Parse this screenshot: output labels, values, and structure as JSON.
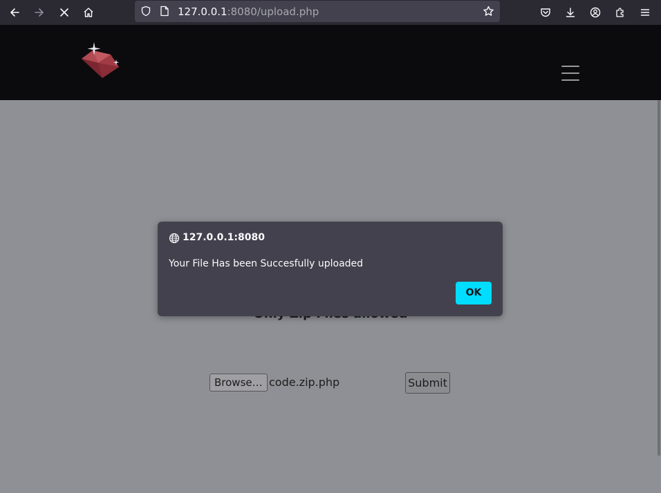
{
  "browser": {
    "url_host": "127.0.0.1",
    "url_rest": ":8080/upload.php"
  },
  "page": {
    "notice": "Only Zip Files allowed",
    "browse_label": "Browse…",
    "file_name": "code.zip.php",
    "submit_label": "Submit"
  },
  "dialog": {
    "title": "127.0.0.1:8080",
    "message": "Your File Has been Succesfully uploaded",
    "ok_label": "OK"
  },
  "colors": {
    "accent": "#00ddff",
    "toolbar": "#2b2a33",
    "urlbar": "#42414d",
    "header": "#0b0b0d",
    "page_overlay": "#8f9095"
  },
  "icons": {
    "toolbar": [
      "back-icon",
      "forward-icon",
      "stop-icon",
      "home-icon",
      "shield-icon",
      "page-icon",
      "star-icon",
      "pocket-icon",
      "download-icon",
      "account-icon",
      "extensions-icon",
      "menu-icon"
    ],
    "dialog": "globe-icon",
    "site": [
      "ruby-logo",
      "hamburger-menu-icon"
    ]
  }
}
